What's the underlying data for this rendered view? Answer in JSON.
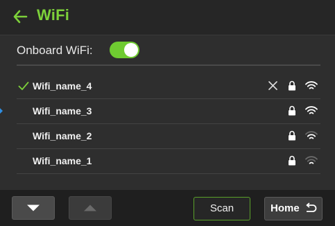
{
  "header": {
    "title": "WiFi",
    "back_icon": "arrow-left-icon"
  },
  "onboard": {
    "label": "Onboard WiFi:",
    "toggle_state": "on"
  },
  "colors": {
    "accent": "#7dd13a",
    "toggle_on": "#6fcb31",
    "background": "#2e2e2e",
    "footer": "#1f1f1f",
    "marker": "#2f8fe3"
  },
  "networks": [
    {
      "name": "Wifi_name_4",
      "connected": true,
      "forget": true,
      "secured": true,
      "signal_bars": 3
    },
    {
      "name": "Wifi_name_3",
      "connected": false,
      "forget": false,
      "secured": true,
      "signal_bars": 3
    },
    {
      "name": "Wifi_name_2",
      "connected": false,
      "forget": false,
      "secured": true,
      "signal_bars": 2
    },
    {
      "name": "Wifi_name_1",
      "connected": false,
      "forget": false,
      "secured": true,
      "signal_bars": 1
    }
  ],
  "footer": {
    "scroll_down_icon": "triangle-down-icon",
    "scroll_up_icon": "triangle-up-icon",
    "scan_label": "Scan",
    "home_label": "Home",
    "home_icon": "return-arrow-icon"
  }
}
